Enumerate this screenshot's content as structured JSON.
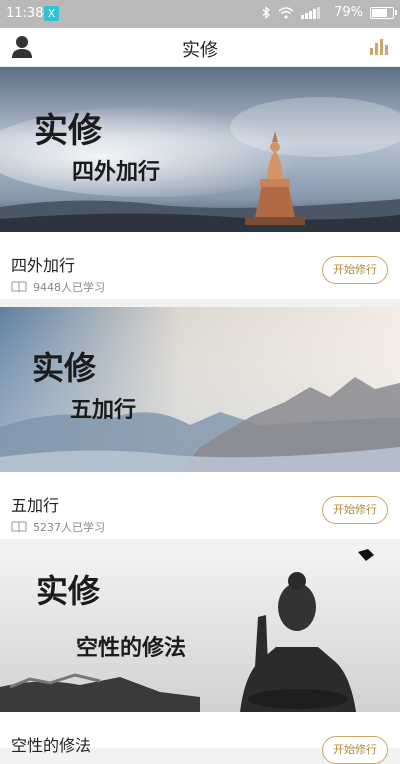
{
  "status_bar": {
    "time": "11:38",
    "app_badge": "X",
    "battery": "79%",
    "battery_level": 0.79
  },
  "header": {
    "title": "实修",
    "left_icon": "user-icon",
    "right_icon": "bar-chart-icon"
  },
  "courses": [
    {
      "banner_title": "实修",
      "banner_subtitle": "四外加行",
      "name": "四外加行",
      "learners": "9448人已学习",
      "button": "开始修行"
    },
    {
      "banner_title": "实修",
      "banner_subtitle": "五加行",
      "name": "五加行",
      "learners": "5237人已学习",
      "button": "开始修行"
    },
    {
      "banner_title": "实修",
      "banner_subtitle": "空性的修法",
      "name": "空性的修法",
      "learners": "",
      "button": "开始修行"
    }
  ],
  "colors": {
    "accent": "#c9a86a",
    "accent_text": "#b48a3a",
    "status_bar": "#b9b9b9"
  }
}
